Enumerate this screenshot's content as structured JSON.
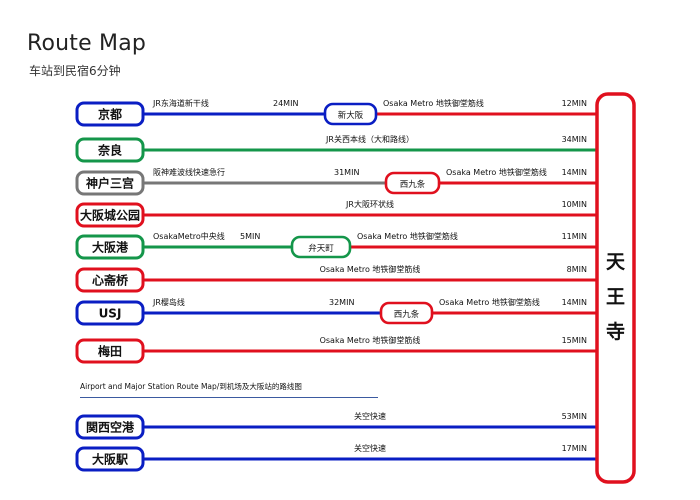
{
  "header": {
    "title": "Route Map",
    "subtitle": "车站到民宿6分钟"
  },
  "colors": {
    "red": "#e0101e",
    "blue": "#0a1ec3",
    "green": "#14964a",
    "gray": "#777777"
  },
  "destination": {
    "chars": [
      "天",
      "王",
      "寺"
    ],
    "color": "red"
  },
  "routes": [
    {
      "station": "京都",
      "color": "blue",
      "segments": [
        {
          "color": "blue",
          "label": "JR东海道新干线",
          "time": "24MIN"
        },
        {
          "color": "red",
          "label": "Osaka Metro   地铁御堂筋线",
          "time": "12MIN"
        }
      ],
      "transfer": {
        "name": "新大阪",
        "color": "blue"
      }
    },
    {
      "station": "奈良",
      "color": "green",
      "segments": [
        {
          "color": "green",
          "label": "JR关西本线（大和路线）",
          "time": "34MIN"
        }
      ]
    },
    {
      "station": "神户三宫",
      "color": "gray",
      "segments": [
        {
          "color": "gray",
          "label": "阪神难波线快速急行",
          "time": "31MIN"
        },
        {
          "color": "red",
          "label": "Osaka Metro   地铁御堂筋线",
          "time": "14MIN"
        }
      ],
      "transfer": {
        "name": "西九条",
        "color": "red"
      }
    },
    {
      "station": "大阪城公园",
      "color": "red",
      "segments": [
        {
          "color": "red",
          "label": "JR大阪环状线",
          "time": "10MIN"
        }
      ]
    },
    {
      "station": "大阪港",
      "color": "green",
      "segments": [
        {
          "color": "green",
          "label": "OsakaMetro中央线",
          "time": "5MIN"
        },
        {
          "color": "red",
          "label": "Osaka Metro   地铁御堂筋线",
          "time": "11MIN"
        }
      ],
      "transfer": {
        "name": "弁天町",
        "color": "green"
      }
    },
    {
      "station": "心斋桥",
      "color": "red",
      "segments": [
        {
          "color": "red",
          "label": "Osaka Metro   地铁御堂筋线",
          "time": "8MIN"
        }
      ]
    },
    {
      "station": "USJ",
      "color": "blue",
      "segments": [
        {
          "color": "blue",
          "label": "JR樱岛线",
          "time": "32MIN"
        },
        {
          "color": "red",
          "label": "Osaka Metro   地铁御堂筋线",
          "time": "14MIN"
        }
      ],
      "transfer": {
        "name": "西九条",
        "color": "red"
      }
    },
    {
      "station": "梅田",
      "color": "red",
      "segments": [
        {
          "color": "red",
          "label": "Osaka Metro   地铁御堂筋线",
          "time": "15MIN"
        }
      ]
    },
    {
      "station": "関西空港",
      "color": "blue",
      "segments": [
        {
          "color": "blue",
          "label": "关空快速",
          "time": "53MIN"
        }
      ]
    },
    {
      "station": "大阪駅",
      "color": "blue",
      "segments": [
        {
          "color": "blue",
          "label": "关空快速",
          "time": "17MIN"
        }
      ]
    }
  ],
  "airport_section": {
    "heading": "Airport and Major Station Route Map/到机场及大阪站的路线图"
  }
}
